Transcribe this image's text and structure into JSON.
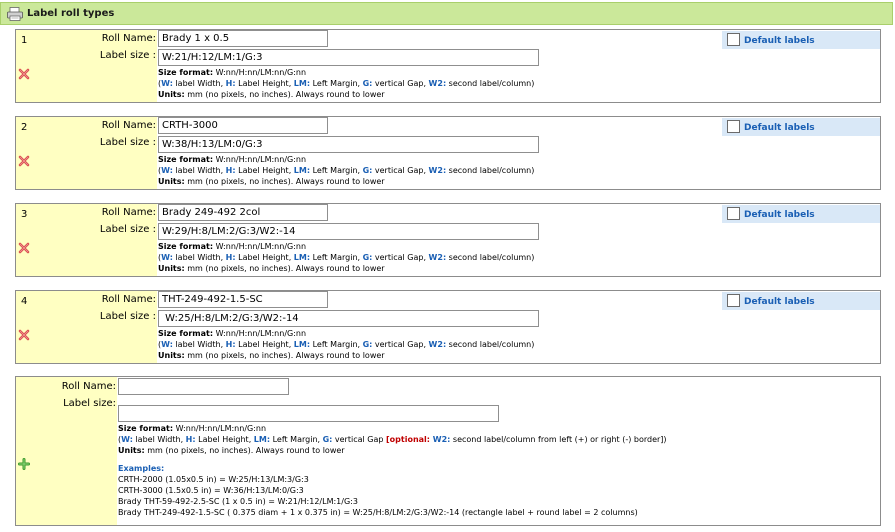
{
  "header": {
    "title": "Label roll types"
  },
  "labels": {
    "roll_name": "Roll Name:",
    "label_size": "Label size :",
    "label_size_new": "Label size:",
    "default_labels": "Default labels"
  },
  "help": {
    "size_format_label": "Size format:",
    "size_format_value": "W:nn/H:nn/LM:nn/G:nn",
    "open_paren": "(",
    "w": "W:",
    "w_desc": " label Width, ",
    "h": "H:",
    "h_desc": " Label Height, ",
    "lm": "LM:",
    "lm_desc": " Left Margin, ",
    "g": "G:",
    "g_desc": " vertical Gap, ",
    "w2": "W2:",
    "w2_desc": " second label/column)",
    "units_label": "Units:",
    "units_value": " mm (no pixels, no inches). Always round to lower"
  },
  "rolls": [
    {
      "num": "1",
      "name": "Brady 1 x 0.5",
      "size": "W:21/H:12/LM:1/G:3"
    },
    {
      "num": "2",
      "name": "CRTH-3000",
      "size": "W:38/H:13/LM:0/G:3"
    },
    {
      "num": "3",
      "name": "Brady 249-492 2col",
      "size": "W:29/H:8/LM:2/G:3/W2:-14"
    },
    {
      "num": "4",
      "name": "THT-249-492-1.5-SC",
      "size": " W:25/H:8/LM:2/G:3/W2:-14"
    }
  ],
  "new_roll": {
    "name": "",
    "size": "",
    "g_desc": " vertical Gap ",
    "optional_open": "[optional: ",
    "w2_desc": " second label/column from left (+) or right (-) border])",
    "examples_title": "Examples:",
    "examples": [
      "CRTH-2000 (1.05x0.5 in) = W:25/H:13/LM:3/G:3",
      "CRTH-3000 (1.5x0.5 in) = W:36/H:13/LM:0/G:3",
      "Brady THT-59-492-2.5-SC (1 x 0.5 in) = W:21/H:12/LM:1/G:3",
      "Brady THT-249-492-1.5-SC ( 0.375 diam + 1 x 0.375 in) = W:25/H:8/LM:2/G:3/W2:-14 (rectangle label + round label = 2 columns)"
    ]
  },
  "colors": {
    "header_bg": "#cbe89a",
    "left_bg": "#ffffc2",
    "accent": "#1a5fb4",
    "optional": "#c00000",
    "tab_bg": "#d9e8f7"
  },
  "icons": {
    "header": "printer-icon",
    "delete": "delete-x-icon",
    "add": "add-plus-icon"
  }
}
